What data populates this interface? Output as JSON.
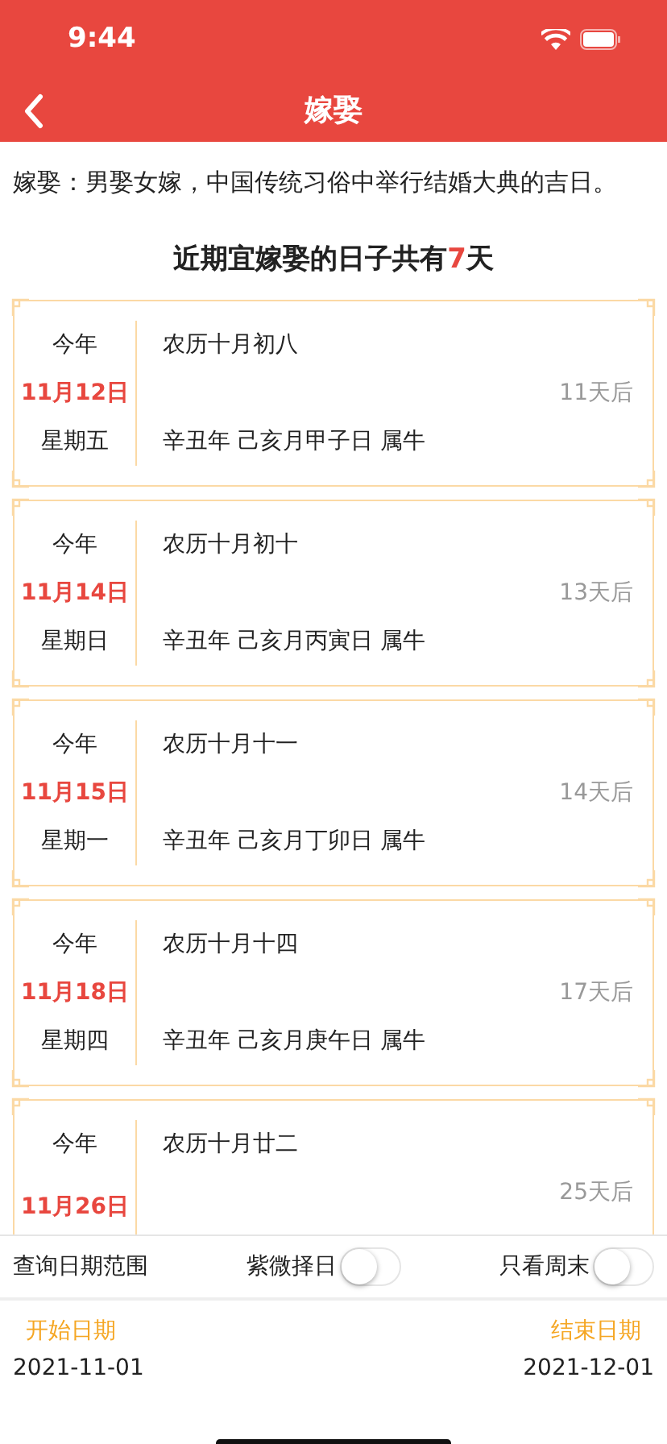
{
  "status_bar": {
    "time": "9:44"
  },
  "nav": {
    "title": "嫁娶"
  },
  "description": "嫁娶：男娶女嫁，中国传统习俗中举行结婚大典的吉日。",
  "summary": {
    "prefix": "近期宜嫁娶的日子共有",
    "count": "7",
    "suffix": "天"
  },
  "days": [
    {
      "year": "今年",
      "date": "11月12日",
      "weekday": "星期五",
      "lunar": "农历十月初八",
      "ganzhi": "辛丑年 己亥月甲子日 属牛",
      "countdown": "11天后"
    },
    {
      "year": "今年",
      "date": "11月14日",
      "weekday": "星期日",
      "lunar": "农历十月初十",
      "ganzhi": "辛丑年 己亥月丙寅日 属牛",
      "countdown": "13天后"
    },
    {
      "year": "今年",
      "date": "11月15日",
      "weekday": "星期一",
      "lunar": "农历十月十一",
      "ganzhi": "辛丑年 己亥月丁卯日 属牛",
      "countdown": "14天后"
    },
    {
      "year": "今年",
      "date": "11月18日",
      "weekday": "星期四",
      "lunar": "农历十月十四",
      "ganzhi": "辛丑年 己亥月庚午日 属牛",
      "countdown": "17天后"
    },
    {
      "year": "今年",
      "date": "11月26日",
      "lunar": "农历十月廿二",
      "countdown": "25天后"
    }
  ],
  "filters": {
    "range_label": "查询日期范围",
    "toggles": [
      {
        "label": "紫微择日",
        "on": false
      },
      {
        "label": "只看周末",
        "on": false
      }
    ]
  },
  "range": {
    "start_label": "开始日期",
    "start": "2021-11-01",
    "end_label": "结束日期",
    "end": "2021-12-01"
  }
}
